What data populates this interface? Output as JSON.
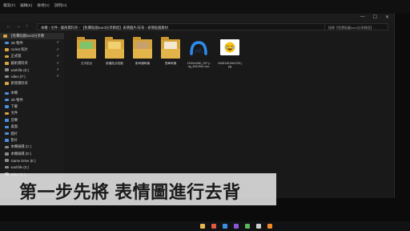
{
  "topbar": {
    "menu": [
      "檔案(F)",
      "編輯(E)",
      "檢視(V)",
      "說明(H)"
    ]
  },
  "window": {
    "controls": [
      "—",
      "☐",
      "✕"
    ]
  },
  "address": {
    "path": "本機 › 文件 › 藝術資料夾 › 【免費貼圖word分享教程】表情圖片/去背 › 表情貼圖素材",
    "search_placeholder": "搜尋【免費貼圖word分享教程】..."
  },
  "nav": {
    "items": [
      {
        "label": "【免費貼圖word分享教",
        "icon": "folder",
        "pin": ""
      },
      {
        "label": "3D 物件",
        "icon": "cube",
        "pin": "✐"
      },
      {
        "label": "rocket 照片",
        "icon": "folder",
        "pin": "✐"
      },
      {
        "label": "正式版",
        "icon": "folder",
        "pin": "✐"
      },
      {
        "label": "藝術資料夾",
        "icon": "folder",
        "pin": "✐"
      },
      {
        "label": "workfile (E:)",
        "icon": "drive",
        "pin": "✐"
      },
      {
        "label": "video (F:)",
        "icon": "drive",
        "pin": "✐"
      },
      {
        "label": "新增資料夾",
        "icon": "folder",
        "pin": ""
      }
    ],
    "pc_items": [
      {
        "label": "本機",
        "icon": "pc"
      },
      {
        "label": "3D 物件",
        "icon": "cube"
      },
      {
        "label": "下載",
        "icon": "download"
      },
      {
        "label": "文件",
        "icon": "doc"
      },
      {
        "label": "音樂",
        "icon": "music"
      },
      {
        "label": "桌面",
        "icon": "desktop"
      },
      {
        "label": "圖片",
        "icon": "picture"
      },
      {
        "label": "影片",
        "icon": "video"
      },
      {
        "label": "本機磁碟 (C:)",
        "icon": "drive"
      },
      {
        "label": "本機磁碟 (D:)",
        "icon": "drive"
      },
      {
        "label": "Game Drive (E:)",
        "icon": "drive"
      },
      {
        "label": "workfile (E:)",
        "icon": "drive"
      },
      {
        "label": "video (F:)",
        "icon": "drive"
      }
    ]
  },
  "files": [
    {
      "label": "文字貼合",
      "type": "folder",
      "paper": "#7fc46a"
    },
    {
      "label": "影檔貼合貼圖",
      "type": "folder",
      "paper": "#f0d070"
    },
    {
      "label": "影時鐘時鐘",
      "type": "folder",
      "paper": "#c8a070"
    },
    {
      "label": "簡單時鐘",
      "type": "folder",
      "paper": "#f3e9d2"
    },
    {
      "label": "1920x1080_GIF png_8410941.eco",
      "type": "logo",
      "paper": "#2d8cf0"
    },
    {
      "label": "34081451964709.jpg",
      "type": "emoji",
      "paper": "#f7c21b"
    }
  ],
  "status": {
    "left": "",
    "items": [
      "",
      ""
    ]
  },
  "caption": {
    "text": "第一步先將 表情圖進行去背"
  },
  "taskbar": {
    "tray": ""
  },
  "colors": {
    "folder": "#d4a43c",
    "caption_bg": "#ebebeb"
  }
}
